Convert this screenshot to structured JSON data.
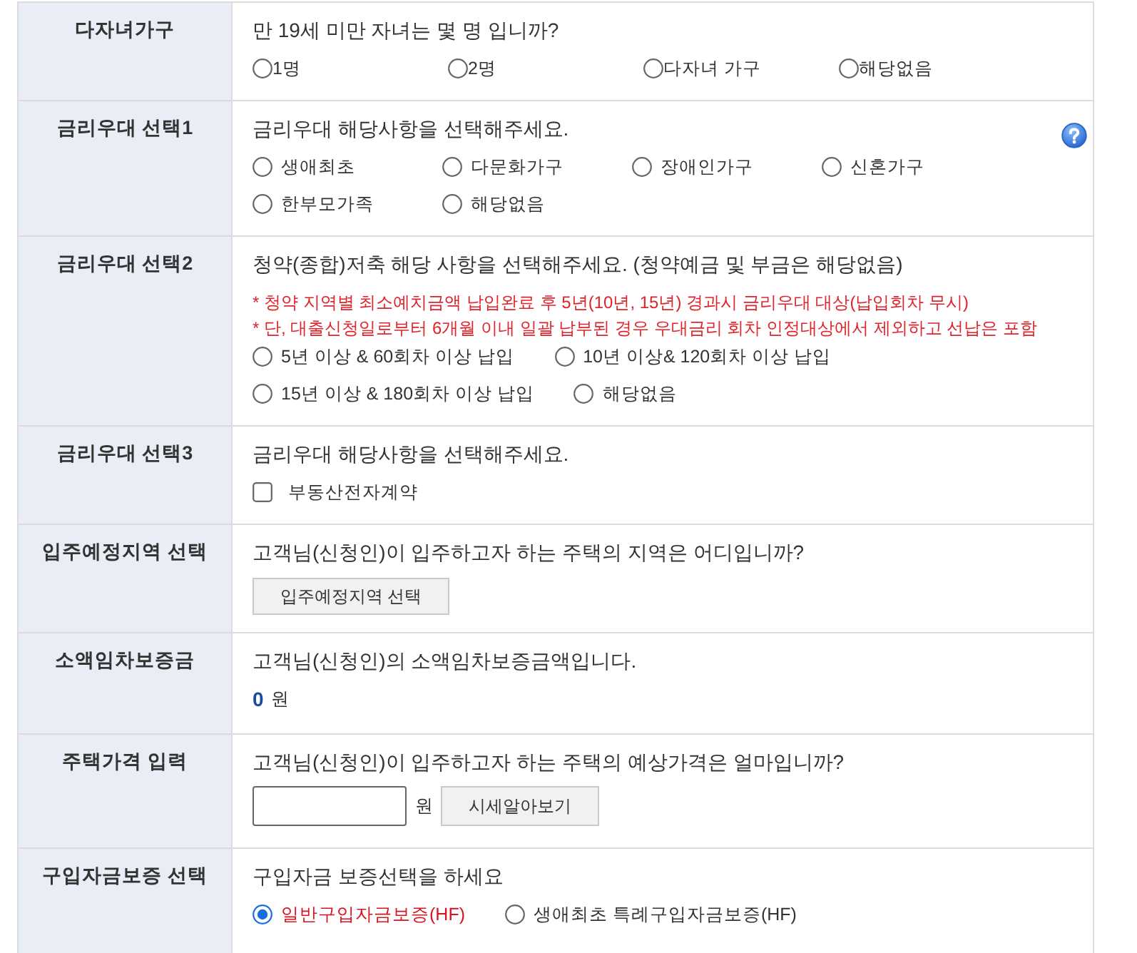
{
  "form_rows": [
    {
      "label": "다자녀가구",
      "content": [
        {
          "kind": "question",
          "text": "만 19세 미만 자녀는 몇 명 입니까?"
        },
        {
          "kind": "radio_grid_tight",
          "options": [
            {
              "label": "1명",
              "selected": false
            },
            {
              "label": "2명",
              "selected": false
            },
            {
              "label": "다자녀 가구",
              "selected": false
            },
            {
              "label": "해당없음",
              "selected": false
            }
          ]
        }
      ]
    },
    {
      "label": "금리우대 선택1",
      "help": true,
      "content": [
        {
          "kind": "question",
          "text": "금리우대 해당사항을 선택해주세요."
        },
        {
          "kind": "radio_grid",
          "options": [
            {
              "label": "생애최초",
              "selected": false
            },
            {
              "label": "다문화가구",
              "selected": false
            },
            {
              "label": "장애인가구",
              "selected": false
            },
            {
              "label": "신혼가구",
              "selected": false
            }
          ]
        },
        {
          "kind": "radio_grid",
          "options": [
            {
              "label": "한부모가족",
              "selected": false
            },
            {
              "label": "해당없음",
              "selected": false
            }
          ]
        }
      ]
    },
    {
      "label": "금리우대 선택2",
      "content": [
        {
          "kind": "question",
          "text": "청약(종합)저축 해당 사항을 선택해주세요. (청약예금 및 부금은 해당없음)"
        },
        {
          "kind": "note",
          "text": "* 청약 지역별 최소예치금액 납입완료 후 5년(10년, 15년) 경과시 금리우대 대상(납입회차 무시)"
        },
        {
          "kind": "note",
          "text": "* 단, 대출신청일로부터 6개월 이내 일괄 납부된 경우 우대금리 회차 인정대상에서 제외하고 선납은 포함"
        },
        {
          "kind": "radio_inline",
          "options": [
            {
              "label": "5년 이상 & 60회차 이상 납입",
              "selected": false
            },
            {
              "label": "10년 이상& 120회차 이상 납입",
              "selected": false
            }
          ]
        },
        {
          "kind": "radio_inline",
          "options": [
            {
              "label": "15년 이상 & 180회차 이상 납입",
              "selected": false
            },
            {
              "label": "해당없음",
              "selected": false
            }
          ]
        }
      ]
    },
    {
      "label": "금리우대 선택3",
      "content": [
        {
          "kind": "question",
          "text": "금리우대 해당사항을 선택해주세요."
        },
        {
          "kind": "checkbox",
          "label": "부동산전자계약",
          "checked": false
        }
      ]
    },
    {
      "label": "입주예정지역 선택",
      "content": [
        {
          "kind": "question",
          "text": "고객님(신청인)이 입주하고자 하는 주택의 지역은 어디입니까?"
        },
        {
          "kind": "button",
          "label": "입주예정지역 선택"
        }
      ]
    },
    {
      "label": "소액임차보증금",
      "content": [
        {
          "kind": "question",
          "text": "고객님(신청인)의 소액임차보증금액입니다."
        },
        {
          "kind": "amount",
          "value": "0",
          "unit": "원"
        }
      ]
    },
    {
      "label": "주택가격 입력",
      "content": [
        {
          "kind": "question",
          "text": "고객님(신청인)이 입주하고자 하는 주택의 예상가격은 얼마입니까?"
        },
        {
          "kind": "price_input",
          "unit": "원",
          "button": "시세알아보기"
        }
      ]
    },
    {
      "label": "구입자금보증 선택",
      "content": [
        {
          "kind": "question",
          "text": "구입자금 보증선택을 하세요"
        },
        {
          "kind": "radio_inline",
          "options": [
            {
              "label": "일반구입자금보증(HF)",
              "selected": true
            },
            {
              "label": "생애최초 특례구입자금보증(HF)",
              "selected": false
            }
          ]
        }
      ]
    }
  ]
}
